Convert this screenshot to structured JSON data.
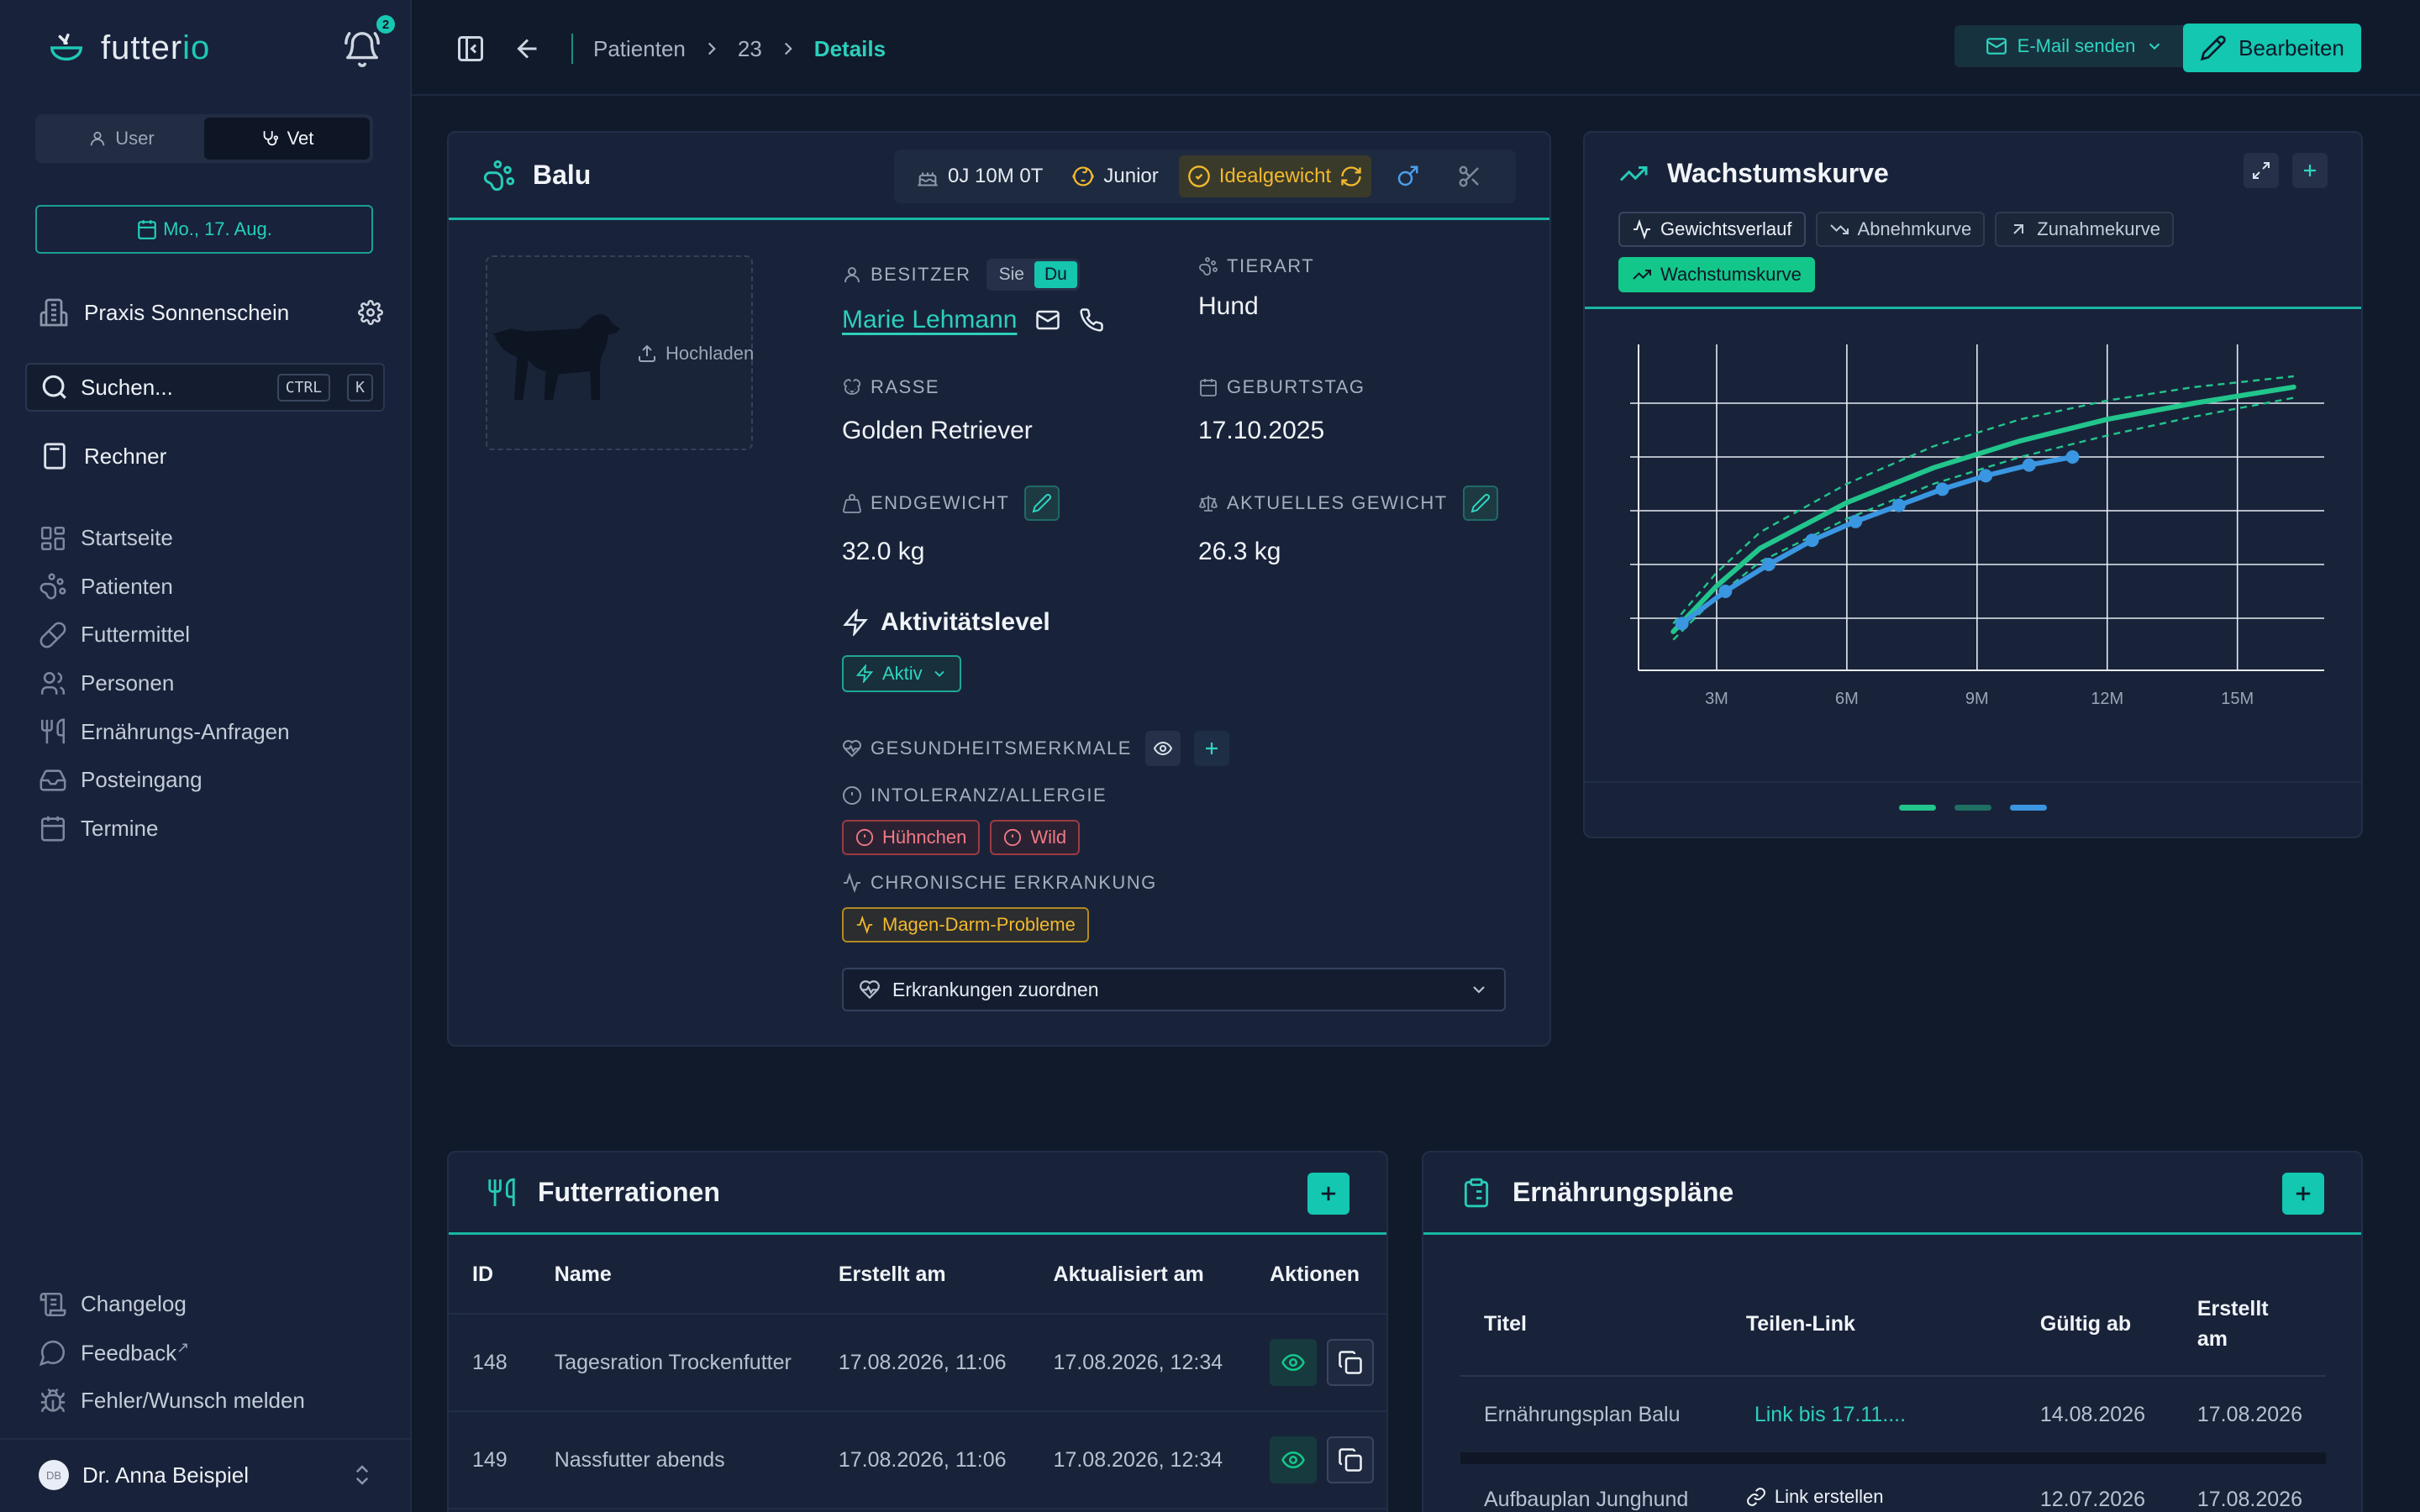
{
  "brand": {
    "name_part1": "futter",
    "name_part2": "io"
  },
  "notifications": {
    "count": "2"
  },
  "role_switch": {
    "user_label": "User",
    "vet_label": "Vet"
  },
  "date_button": {
    "label": "Mo., 17. Aug."
  },
  "practice": {
    "name": "Praxis Sonnenschein"
  },
  "search": {
    "placeholder": "Suchen...",
    "shortcut_ctrl": "CTRL",
    "shortcut_key": "K"
  },
  "rechner": {
    "label": "Rechner"
  },
  "nav": [
    {
      "label": "Startseite",
      "icon": "grid-icon"
    },
    {
      "label": "Patienten",
      "icon": "paw-icon"
    },
    {
      "label": "Futtermittel",
      "icon": "pill-icon"
    },
    {
      "label": "Personen",
      "icon": "users-icon"
    },
    {
      "label": "Ernährungs-Anfragen",
      "icon": "utensils-icon"
    },
    {
      "label": "Posteingang",
      "icon": "inbox-icon"
    },
    {
      "label": "Termine",
      "icon": "calendar-icon"
    }
  ],
  "footer_links": {
    "changelog": "Changelog",
    "feedback": "Feedback",
    "bug": "Fehler/Wunsch melden"
  },
  "user": {
    "initials": "DB",
    "name": "Dr. Anna Beispiel"
  },
  "breadcrumb": {
    "patients": "Patienten",
    "id": "23",
    "current": "Details"
  },
  "topbar": {
    "email_label": "E-Mail senden",
    "edit_label": "Bearbeiten"
  },
  "patient": {
    "name": "Balu",
    "age": "0J 10M 0T",
    "life_stage": "Junior",
    "weight_status": "Idealgewicht",
    "upload_label": "Hochladen",
    "owner_label": "Besitzer",
    "owner_sie": "Sie",
    "owner_du": "Du",
    "owner_name": "Marie Lehmann",
    "species_label": "Tierart",
    "species": "Hund",
    "breed_label": "Rasse",
    "breed": "Golden Retriever",
    "birthday_label": "Geburtstag",
    "birthday": "17.10.2025",
    "final_weight_label": "Endgewicht",
    "final_weight": "32.0 kg",
    "current_weight_label": "Aktuelles Gewicht",
    "current_weight": "26.3 kg",
    "activity_title": "Aktivitätslevel",
    "activity_value": "Aktiv",
    "health_label": "Gesundheitsmerkmale",
    "intolerance_label": "Intoleranz/Allergie",
    "intolerances": [
      "Hühnchen",
      "Wild"
    ],
    "chronic_label": "Chronische Erkrankung",
    "chronic": [
      "Magen-Darm-Probleme"
    ],
    "assign_label": "Erkrankungen zuordnen"
  },
  "growth": {
    "title": "Wachstumskurve",
    "tabs": [
      "Gewichtsverlauf",
      "Abnehmkurve",
      "Zunahmekurve",
      "Wachstumskurve"
    ],
    "colors": {
      "curve": "#22c58b",
      "measured": "#3a96e0",
      "band": "#22c58b"
    }
  },
  "chart_data": {
    "type": "line",
    "x_tick_labels": [
      "3M",
      "6M",
      "9M",
      "12M",
      "15M"
    ],
    "xlim": [
      1.2,
      17
    ],
    "series": [
      {
        "x": [
          2,
          3,
          4,
          6,
          8,
          10,
          12,
          14,
          16.3
        ],
        "values": [
          0.05,
          0.22,
          0.36,
          0.53,
          0.66,
          0.76,
          0.84,
          0.9,
          0.96
        ]
      },
      {
        "x": [
          2,
          3,
          4,
          6,
          8,
          10,
          12,
          14,
          16.3
        ],
        "values": [
          0.08,
          0.27,
          0.42,
          0.6,
          0.74,
          0.84,
          0.91,
          0.96,
          1.0
        ]
      },
      {
        "x": [
          2,
          3,
          4,
          6,
          8,
          10,
          12,
          14,
          16.3
        ],
        "values": [
          0.02,
          0.18,
          0.31,
          0.47,
          0.6,
          0.7,
          0.78,
          0.85,
          0.92
        ]
      },
      {
        "x": [
          2.2,
          3.2,
          4.2,
          5.2,
          6.2,
          7.2,
          8.2,
          9.2,
          10.2,
          11.2
        ],
        "values": [
          0.08,
          0.2,
          0.3,
          0.39,
          0.46,
          0.52,
          0.58,
          0.63,
          0.67,
          0.7
        ]
      }
    ]
  },
  "rations": {
    "title": "Futterrationen",
    "columns": [
      "ID",
      "Name",
      "Erstellt am",
      "Aktualisiert am",
      "Aktionen"
    ],
    "rows": [
      {
        "id": "148",
        "name": "Tagesration Trockenfutter",
        "created": "17.08.2026, 11:06",
        "updated": "17.08.2026, 12:34"
      },
      {
        "id": "149",
        "name": "Nassfutter abends",
        "created": "17.08.2026, 11:06",
        "updated": "17.08.2026, 12:34"
      }
    ]
  },
  "plans": {
    "title": "Ernährungspläne",
    "columns": [
      "Titel",
      "Teilen-Link",
      "Gültig ab",
      "Erstellt am"
    ],
    "rows": [
      {
        "title": "Ernährungsplan Balu",
        "link": "Link bis 17.11....",
        "valid": "14.08.2026",
        "created": "17.08.2026"
      },
      {
        "title": "Aufbauplan Junghund",
        "link": "Link erstellen",
        "valid": "12.07.2026",
        "created": "17.08.2026"
      }
    ]
  }
}
